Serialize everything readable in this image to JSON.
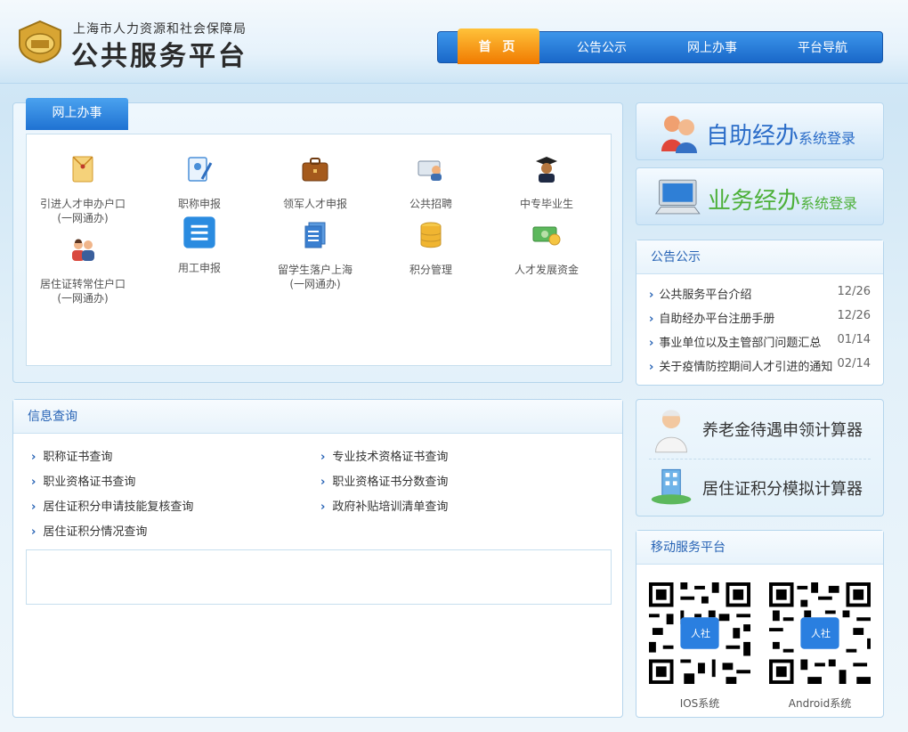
{
  "header": {
    "subtitle": "上海市人力资源和社会保障局",
    "title": "公共服务平台",
    "nav": [
      "首 页",
      "公告公示",
      "网上办事",
      "平台导航"
    ]
  },
  "online_services": {
    "tab": "网上办事",
    "items": [
      {
        "label": "引进人才申办户口",
        "sub": "(一网通办)",
        "icon": "folder-icon"
      },
      {
        "label": "职称申报",
        "sub": "",
        "icon": "certificate-edit-icon"
      },
      {
        "label": "领军人才申报",
        "sub": "",
        "icon": "briefcase-icon"
      },
      {
        "label": "公共招聘",
        "sub": "",
        "icon": "recruit-card-icon"
      },
      {
        "label": "中专毕业生",
        "sub": "",
        "icon": "graduate-icon"
      },
      {
        "label": "居住证转常住户口",
        "sub": "(一网通办)",
        "icon": "couple-icon"
      },
      {
        "label": "用工申报",
        "sub": "",
        "icon": "list-doc-icon"
      },
      {
        "label": "留学生落户上海",
        "sub": "(一网通办)",
        "icon": "documents-icon"
      },
      {
        "label": "积分管理",
        "sub": "",
        "icon": "database-icon"
      },
      {
        "label": "人才发展资金",
        "sub": "",
        "icon": "money-icon"
      }
    ]
  },
  "info_query": {
    "title": "信息查询",
    "left": [
      "职称证书查询",
      "职业资格证书查询",
      "居住证积分申请技能复核查询",
      "居住证积分情况查询"
    ],
    "right": [
      "专业技术资格证书查询",
      "职业资格证书分数查询",
      "政府补贴培训清单查询"
    ]
  },
  "logins": {
    "self_service": {
      "main": "自助经办",
      "sub": "系统登录"
    },
    "business": {
      "main": "业务经办",
      "sub": "系统登录"
    }
  },
  "notices": {
    "title": "公告公示",
    "items": [
      {
        "title": "公共服务平台介绍",
        "date": "12/26"
      },
      {
        "title": "自助经办平台注册手册",
        "date": "12/26"
      },
      {
        "title": "事业单位以及主管部门问题汇总",
        "date": "01/14"
      },
      {
        "title": "关于疫情防控期间人才引进的通知",
        "date": "02/14"
      }
    ]
  },
  "calculators": [
    "养老金待遇申领计算器",
    "居住证积分模拟计算器"
  ],
  "mobile": {
    "title": "移动服务平台",
    "qr_badge": "人社",
    "ios": "IOS系统",
    "android": "Android系统"
  },
  "colors": {
    "accent": "#2763b5",
    "nav": "#1f72d2",
    "active": "#f08a00"
  }
}
